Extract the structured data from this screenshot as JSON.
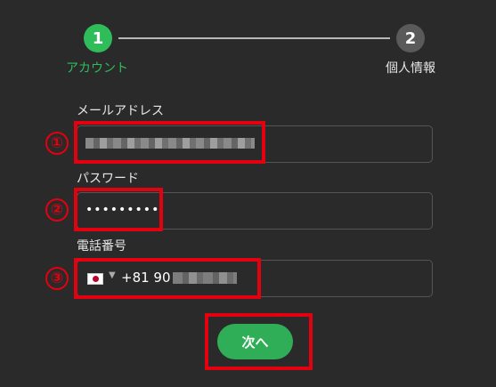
{
  "stepper": {
    "steps": [
      {
        "number": "1",
        "label": "アカウント",
        "state": "active"
      },
      {
        "number": "2",
        "label": "個人情報",
        "state": "inactive"
      }
    ],
    "active_color": "#2fbd5a",
    "inactive_color": "#5a5a5a"
  },
  "form": {
    "email": {
      "label": "メールアドレス",
      "value_state": "redacted"
    },
    "password": {
      "label": "パスワード",
      "value": "•••••••••"
    },
    "phone": {
      "label": "電話番号",
      "country_flag": "japan-flag-icon",
      "prefix": "+81 90",
      "value_state": "redacted"
    },
    "submit_label": "次へ"
  },
  "annotations": {
    "markers": [
      "①",
      "②",
      "③"
    ],
    "highlight_color": "#e3000f"
  }
}
